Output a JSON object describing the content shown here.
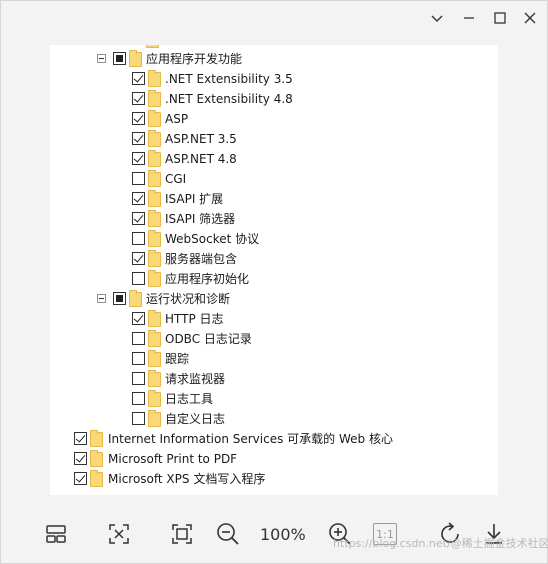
{
  "window": {
    "controls": [
      "chevron-down-icon",
      "minimize-icon",
      "maximize-icon",
      "close-icon"
    ]
  },
  "tree": {
    "groups": [
      {
        "label": "应用程序开发功能",
        "state": "partial",
        "items": [
          {
            "label": ".NET Extensibility 3.5",
            "checked": true
          },
          {
            "label": ".NET Extensibility 4.8",
            "checked": true
          },
          {
            "label": "ASP",
            "checked": true
          },
          {
            "label": "ASP.NET 3.5",
            "checked": true
          },
          {
            "label": "ASP.NET 4.8",
            "checked": true
          },
          {
            "label": "CGI",
            "checked": false
          },
          {
            "label": "ISAPI 扩展",
            "checked": true
          },
          {
            "label": "ISAPI 筛选器",
            "checked": true
          },
          {
            "label": "WebSocket 协议",
            "checked": false
          },
          {
            "label": "服务器端包含",
            "checked": true
          },
          {
            "label": "应用程序初始化",
            "checked": false
          }
        ]
      },
      {
        "label": "运行状况和诊断",
        "state": "partial",
        "items": [
          {
            "label": "HTTP 日志",
            "checked": true
          },
          {
            "label": "ODBC 日志记录",
            "checked": false
          },
          {
            "label": "跟踪",
            "checked": false
          },
          {
            "label": "请求监视器",
            "checked": false
          },
          {
            "label": "日志工具",
            "checked": false
          },
          {
            "label": "自定义日志",
            "checked": false
          }
        ]
      }
    ],
    "root_items": [
      {
        "label": "Internet Information Services 可承载的 Web 核心",
        "checked": true
      },
      {
        "label": "Microsoft Print to PDF",
        "checked": true
      },
      {
        "label": "Microsoft XPS 文档写入程序",
        "checked": true
      }
    ]
  },
  "toolbar": {
    "zoom_level": "100%",
    "one_to_one_label": "1:1"
  },
  "watermark": "https://blog.csdn.net/@稀土掘金技术社区"
}
